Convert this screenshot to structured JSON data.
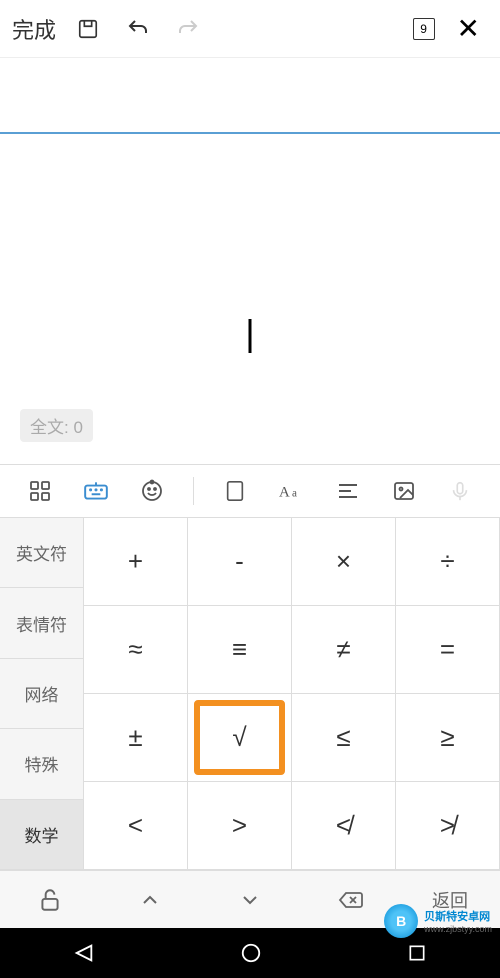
{
  "topbar": {
    "done": "完成",
    "page_number": "9"
  },
  "word_count": {
    "label": "全文: 0"
  },
  "categories": [
    {
      "label": "英文符"
    },
    {
      "label": "表情符"
    },
    {
      "label": "网络"
    },
    {
      "label": "特殊"
    },
    {
      "label": "数学"
    }
  ],
  "active_category_index": 4,
  "symbols": [
    {
      "glyph": "+"
    },
    {
      "glyph": "-"
    },
    {
      "glyph": "×"
    },
    {
      "glyph": "÷"
    },
    {
      "glyph": "≈"
    },
    {
      "glyph": "≡"
    },
    {
      "glyph": "≠"
    },
    {
      "glyph": "="
    },
    {
      "glyph": "±"
    },
    {
      "glyph": "√",
      "highlighted": true
    },
    {
      "glyph": "≤"
    },
    {
      "glyph": "≥"
    },
    {
      "glyph": "<"
    },
    {
      "glyph": ">"
    },
    {
      "glyph": "≮"
    },
    {
      "glyph": "≯"
    }
  ],
  "bottom_bar": {
    "back_label": "返回"
  },
  "watermark": {
    "brand": "贝斯特安卓网",
    "url": "www.zjbstyy.com"
  }
}
